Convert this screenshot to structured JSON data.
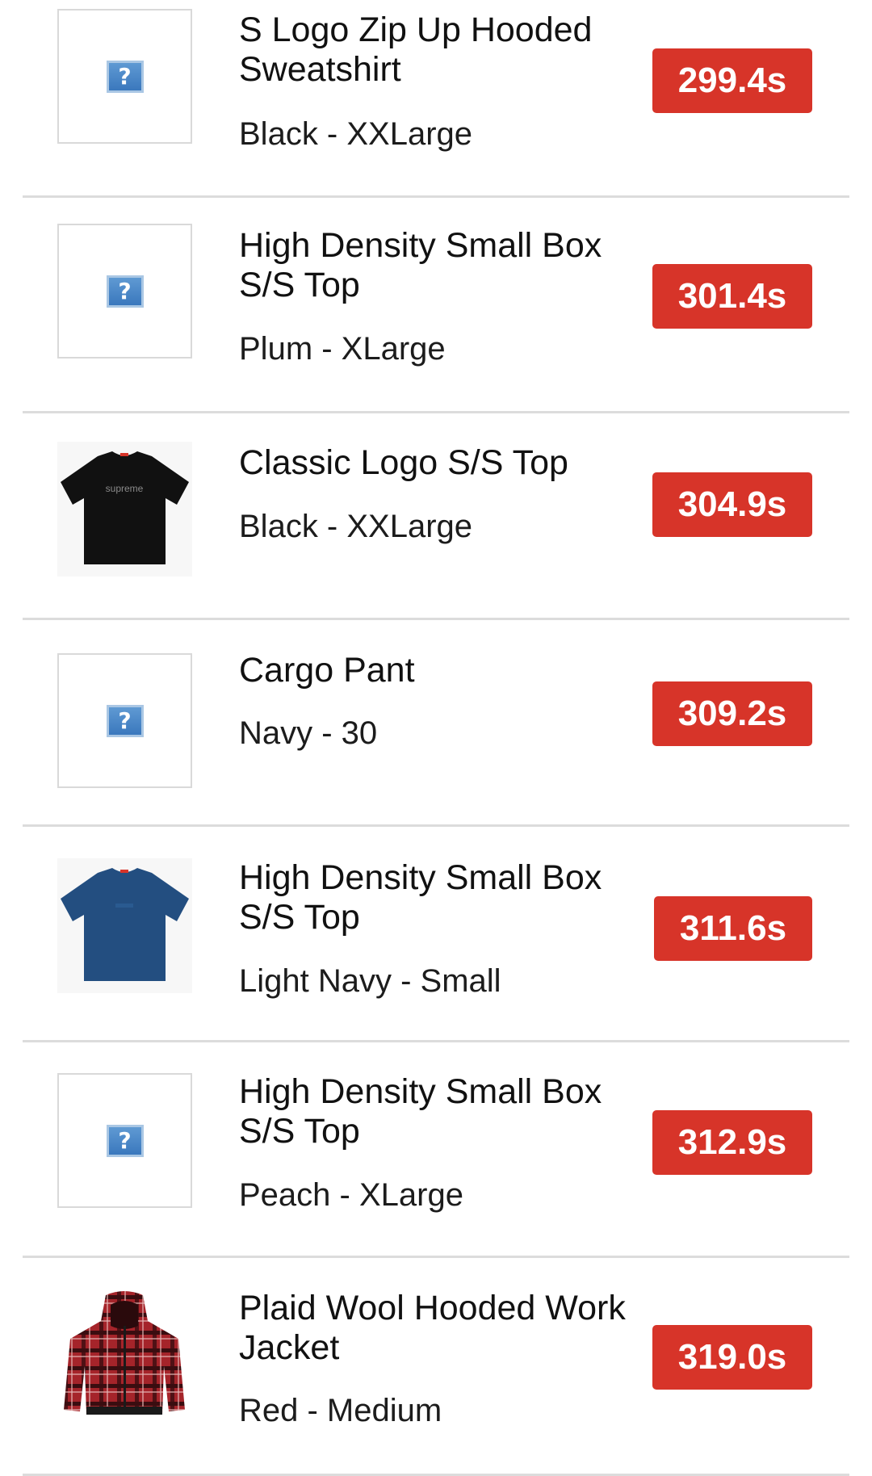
{
  "items": [
    {
      "name": "S Logo Zip Up Hooded Sweatshirt",
      "variant": "Black - XXLarge",
      "time": "299.4s",
      "image": "broken-image-icon"
    },
    {
      "name": "High Density Small Box S/S Top",
      "variant": "Plum - XLarge",
      "time": "301.4s",
      "image": "broken-image-icon"
    },
    {
      "name": "Classic Logo S/S Top",
      "variant": "Black - XXLarge",
      "time": "304.9s",
      "image": "black-tee-image",
      "image_text": "supreme"
    },
    {
      "name": "Cargo Pant",
      "variant": "Navy - 30",
      "time": "309.2s",
      "image": "broken-image-icon"
    },
    {
      "name": "High Density Small Box S/S Top",
      "variant": "Light Navy - Small",
      "time": "311.6s",
      "image": "navy-tee-image"
    },
    {
      "name": "High Density Small Box S/S Top",
      "variant": "Peach - XLarge",
      "time": "312.9s",
      "image": "broken-image-icon"
    },
    {
      "name": "Plaid Wool Hooded Work Jacket",
      "variant": "Red - Medium",
      "time": "319.0s",
      "image": "plaid-jacket-image"
    }
  ],
  "placeholder_glyph": "?",
  "colors": {
    "badge": "#d73429",
    "divider": "#dcdcdc",
    "broken_icon": "#4a86c6"
  }
}
